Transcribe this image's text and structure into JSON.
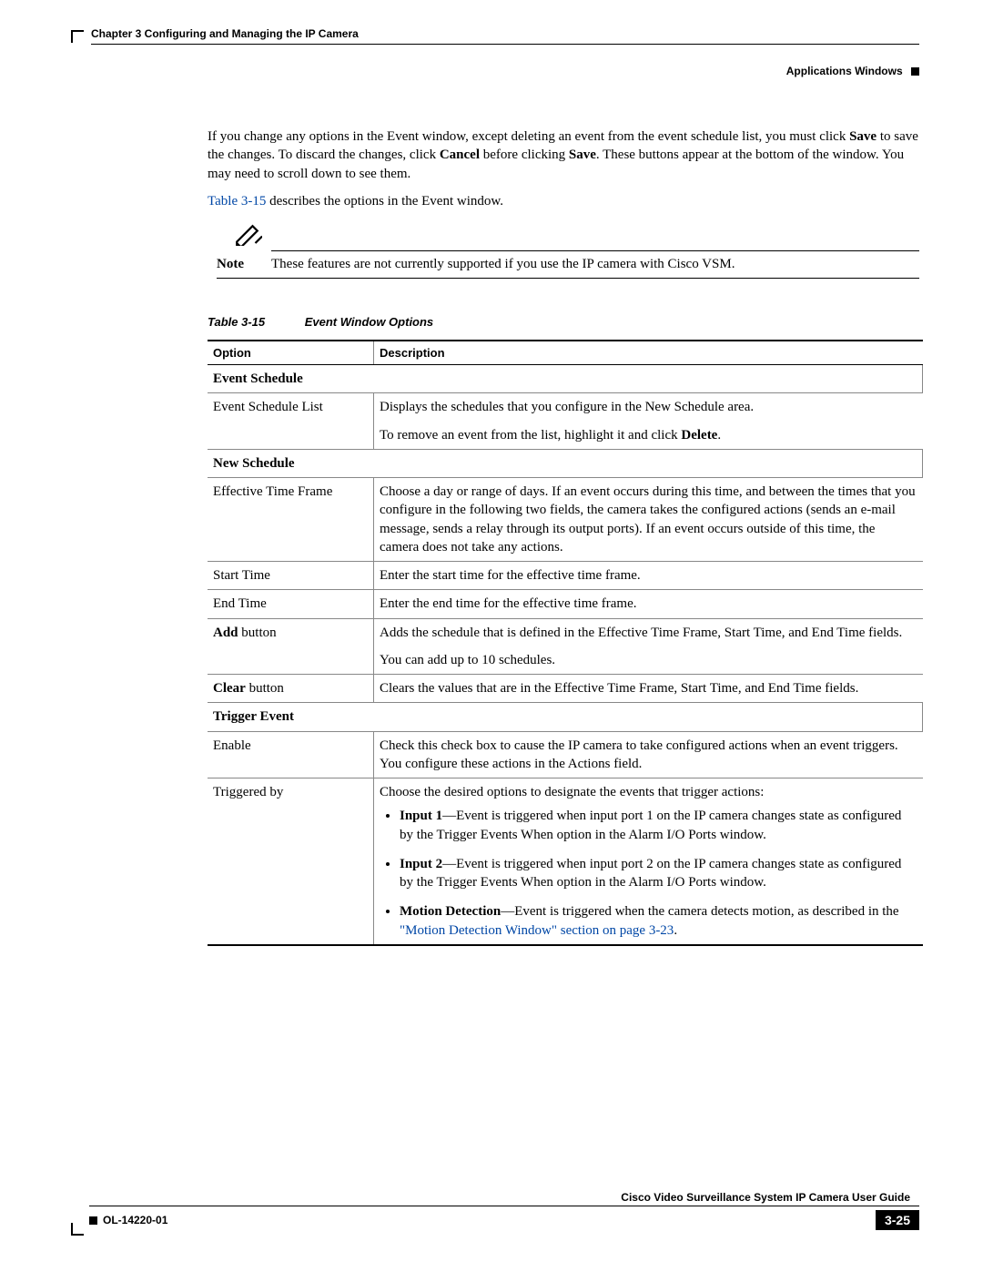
{
  "header": {
    "chapter": "Chapter 3      Configuring and Managing the IP Camera",
    "section": "Applications Windows"
  },
  "intro": {
    "p1a": "If you change any options in the Event window, except deleting an event from the event schedule list, you must click ",
    "p1b": "Save",
    "p1c": " to save the changes. To discard the changes, click ",
    "p1d": "Cancel",
    "p1e": " before clicking ",
    "p1f": "Save",
    "p1g": ". These buttons appear at the bottom of the window. You may need to scroll down to see them.",
    "link": "Table 3-15",
    "p2": " describes the options in the Event window."
  },
  "note": {
    "label": "Note",
    "text": "These features are not currently supported if you use the IP camera with Cisco VSM."
  },
  "table": {
    "caption_num": "Table 3-15",
    "caption_title": "Event Window Options",
    "h1": "Option",
    "h2": "Description",
    "sec1": "Event Schedule",
    "r1o": "Event Schedule List",
    "r1d1": "Displays the schedules that you configure in the New Schedule area.",
    "r1d2a": "To remove an event from the list, highlight it and click ",
    "r1d2b": "Delete",
    "r1d2c": ".",
    "sec2": "New Schedule",
    "r2o": "Effective Time Frame",
    "r2d": "Choose a day or range of days. If an event occurs during this time, and between the times that you configure in the following two fields, the camera takes the configured actions (sends an e-mail message, sends a relay through its output ports). If an event occurs outside of this time, the camera does not take any actions.",
    "r3o": "Start Time",
    "r3d": "Enter the start time for the effective time frame.",
    "r4o": "End Time",
    "r4d": "Enter the end time for the effective time frame.",
    "r5oa": "Add",
    "r5ob": " button",
    "r5d1": "Adds the schedule that is defined in the Effective Time Frame, Start Time, and End Time fields.",
    "r5d2": "You can add up to 10 schedules.",
    "r6oa": "Clear",
    "r6ob": " button",
    "r6d": "Clears the values that are in the Effective Time Frame, Start Time, and End Time fields.",
    "sec3": "Trigger Event",
    "r7o": "Enable",
    "r7d": "Check this check box to cause the IP camera to take configured actions when an event triggers. You configure these actions in the Actions field.",
    "r8o": "Triggered by",
    "r8d": "Choose the desired options to designate the events that trigger actions:",
    "r8l1a": "Input 1",
    "r8l1b": "—Event is triggered when input port 1 on the IP camera changes state as configured by the Trigger Events When option in the Alarm I/O Ports window.",
    "r8l2a": "Input 2",
    "r8l2b": "—Event is triggered when input port 2 on the IP camera changes state as configured by the Trigger Events When option in the Alarm I/O Ports window.",
    "r8l3a": "Motion Detection",
    "r8l3b": "—Event is triggered when the camera detects motion, as described in the ",
    "r8l3link": "\"Motion Detection Window\" section on page 3-23",
    "r8l3c": "."
  },
  "footer": {
    "title": "Cisco Video Surveillance System IP Camera User Guide",
    "doc": "OL-14220-01",
    "page": "3-25"
  }
}
